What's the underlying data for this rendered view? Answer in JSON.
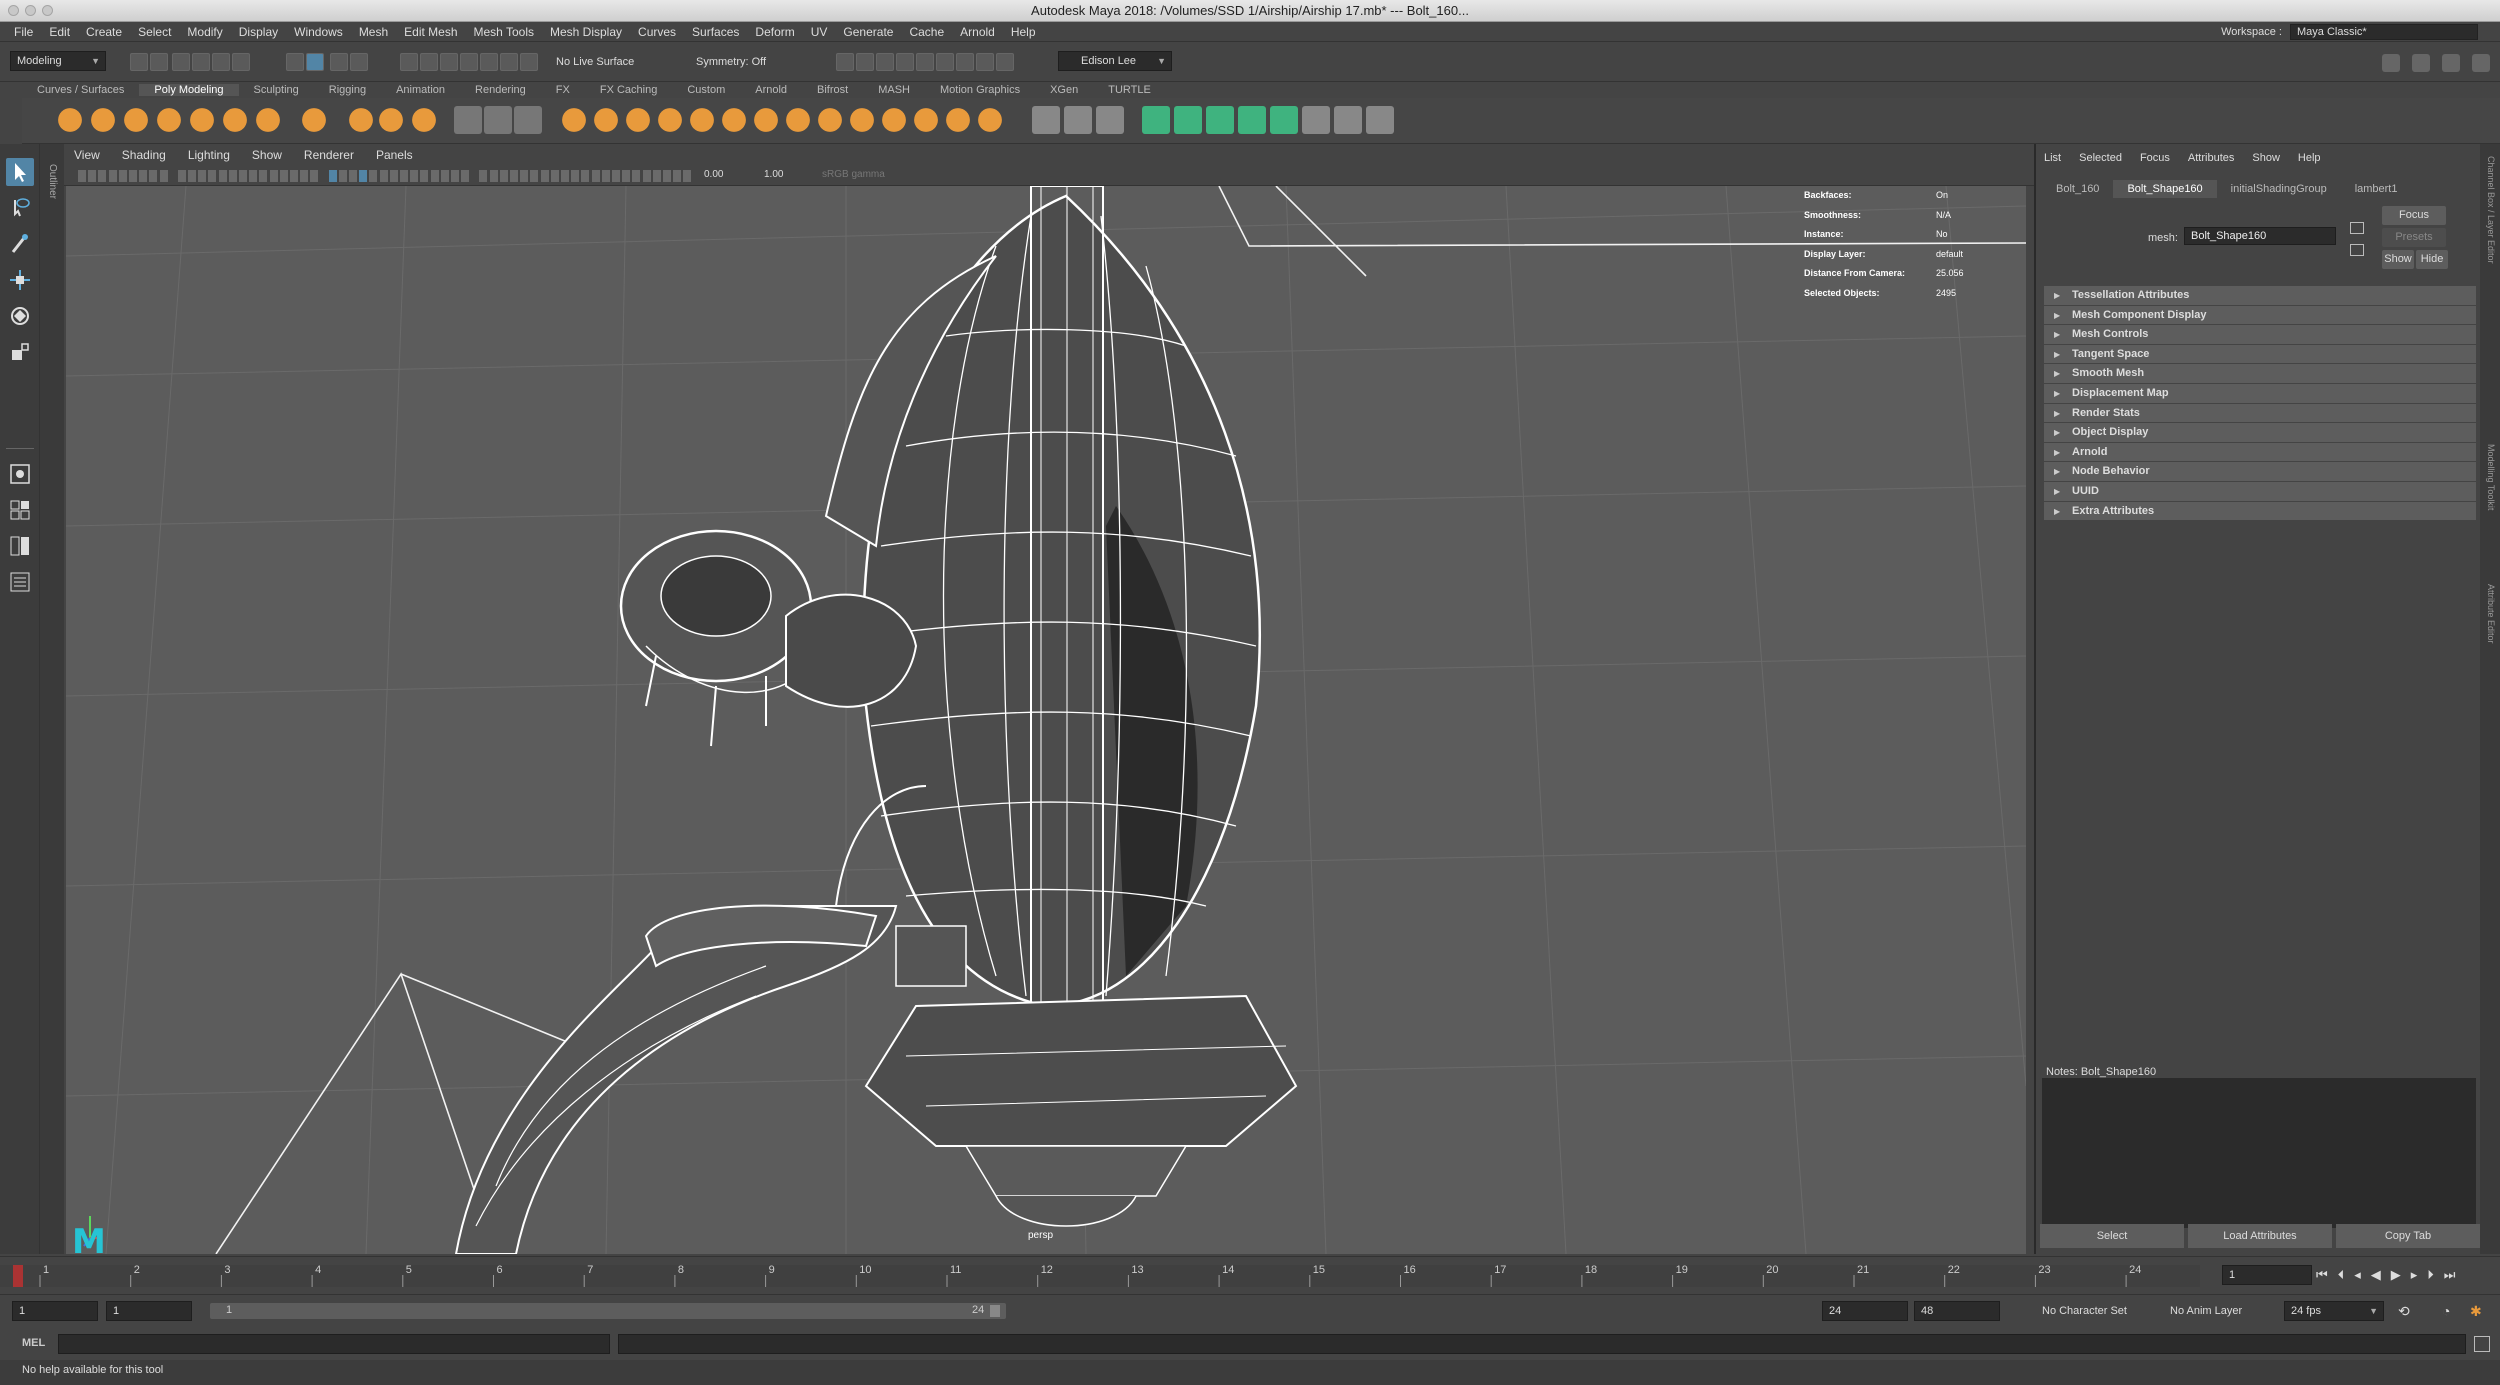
{
  "window": {
    "title": "Autodesk Maya 2018: /Volumes/SSD 1/Airship/Airship 17.mb*   ---   Bolt_160..."
  },
  "menubar": {
    "items": [
      "File",
      "Edit",
      "Create",
      "Select",
      "Modify",
      "Display",
      "Windows",
      "Mesh",
      "Edit Mesh",
      "Mesh Tools",
      "Mesh Display",
      "Curves",
      "Surfaces",
      "Deform",
      "UV",
      "Generate",
      "Cache",
      "Arnold",
      "Help"
    ],
    "workspace_label": "Workspace :",
    "workspace_value": "Maya Classic*"
  },
  "statusline": {
    "mode": "Modeling",
    "live_surface": "No Live Surface",
    "symmetry": "Symmetry: Off",
    "user": "Edison Lee"
  },
  "shelf": {
    "tabs": [
      "Curves / Surfaces",
      "Poly Modeling",
      "Sculpting",
      "Rigging",
      "Animation",
      "Rendering",
      "FX",
      "FX Caching",
      "Custom",
      "Arnold",
      "Bifrost",
      "MASH",
      "Motion Graphics",
      "XGen",
      "TURTLE"
    ],
    "active_tab": "Poly Modeling"
  },
  "toolbox": {
    "outliner_label": "Outliner"
  },
  "viewport": {
    "menu": [
      "View",
      "Shading",
      "Lighting",
      "Show",
      "Renderer",
      "Panels"
    ],
    "exposure": "0.00",
    "gamma": "1.00",
    "color_space": "sRGB gamma",
    "camera": "persp",
    "hud": [
      {
        "key": "Backfaces:",
        "value": "On"
      },
      {
        "key": "Smoothness:",
        "value": "N/A"
      },
      {
        "key": "Instance:",
        "value": "No"
      },
      {
        "key": "Display Layer:",
        "value": "default"
      },
      {
        "key": "Distance From Camera:",
        "value": "25.056"
      },
      {
        "key": "Selected Objects:",
        "value": "2495"
      }
    ],
    "logo": "M"
  },
  "attribute_editor": {
    "menu": [
      "List",
      "Selected",
      "Focus",
      "Attributes",
      "Show",
      "Help"
    ],
    "tabs": [
      "Bolt_160",
      "Bolt_Shape160",
      "initialShadingGroup",
      "lambert1"
    ],
    "active_tab": "Bolt_Shape160",
    "mesh_label": "mesh:",
    "mesh_value": "Bolt_Shape160",
    "focus_btn": "Focus",
    "presets_btn": "Presets",
    "show_btn": "Show",
    "hide_btn": "Hide",
    "sections": [
      "Tessellation Attributes",
      "Mesh Component Display",
      "Mesh Controls",
      "Tangent Space",
      "Smooth Mesh",
      "Displacement Map",
      "Render Stats",
      "Object Display",
      "Arnold",
      "Node Behavior",
      "UUID",
      "Extra Attributes"
    ],
    "notes_label": "Notes:  Bolt_Shape160",
    "bottom_buttons": [
      "Select",
      "Load Attributes",
      "Copy Tab"
    ]
  },
  "right_strip": [
    "Channel Box / Layer Editor",
    "Modelling Toolkit",
    "Attribute Editor"
  ],
  "timeslider": {
    "ticks": [
      "1",
      "2",
      "3",
      "4",
      "5",
      "6",
      "7",
      "8",
      "9",
      "10",
      "11",
      "12",
      "13",
      "14",
      "15",
      "16",
      "17",
      "18",
      "19",
      "20",
      "21",
      "22",
      "23",
      "24"
    ],
    "current_frame": "1",
    "range_start": "1",
    "playback_start": "1",
    "range_inner_start": "1",
    "range_inner_end": "24",
    "playback_end": "24",
    "range_end": "48",
    "character_set": "No Character Set",
    "anim_layer": "No Anim Layer",
    "fps": "24 fps"
  },
  "cmdline": {
    "label": "MEL"
  },
  "helpline": {
    "text": "No help available for this tool"
  },
  "colors": {
    "accent_orange": "#e89a3c",
    "accent_green": "#3fb37f",
    "selection_blue": "#5285a6",
    "viewport_bg": "#5c5c5c",
    "maya_logo": "#26c4d4"
  }
}
